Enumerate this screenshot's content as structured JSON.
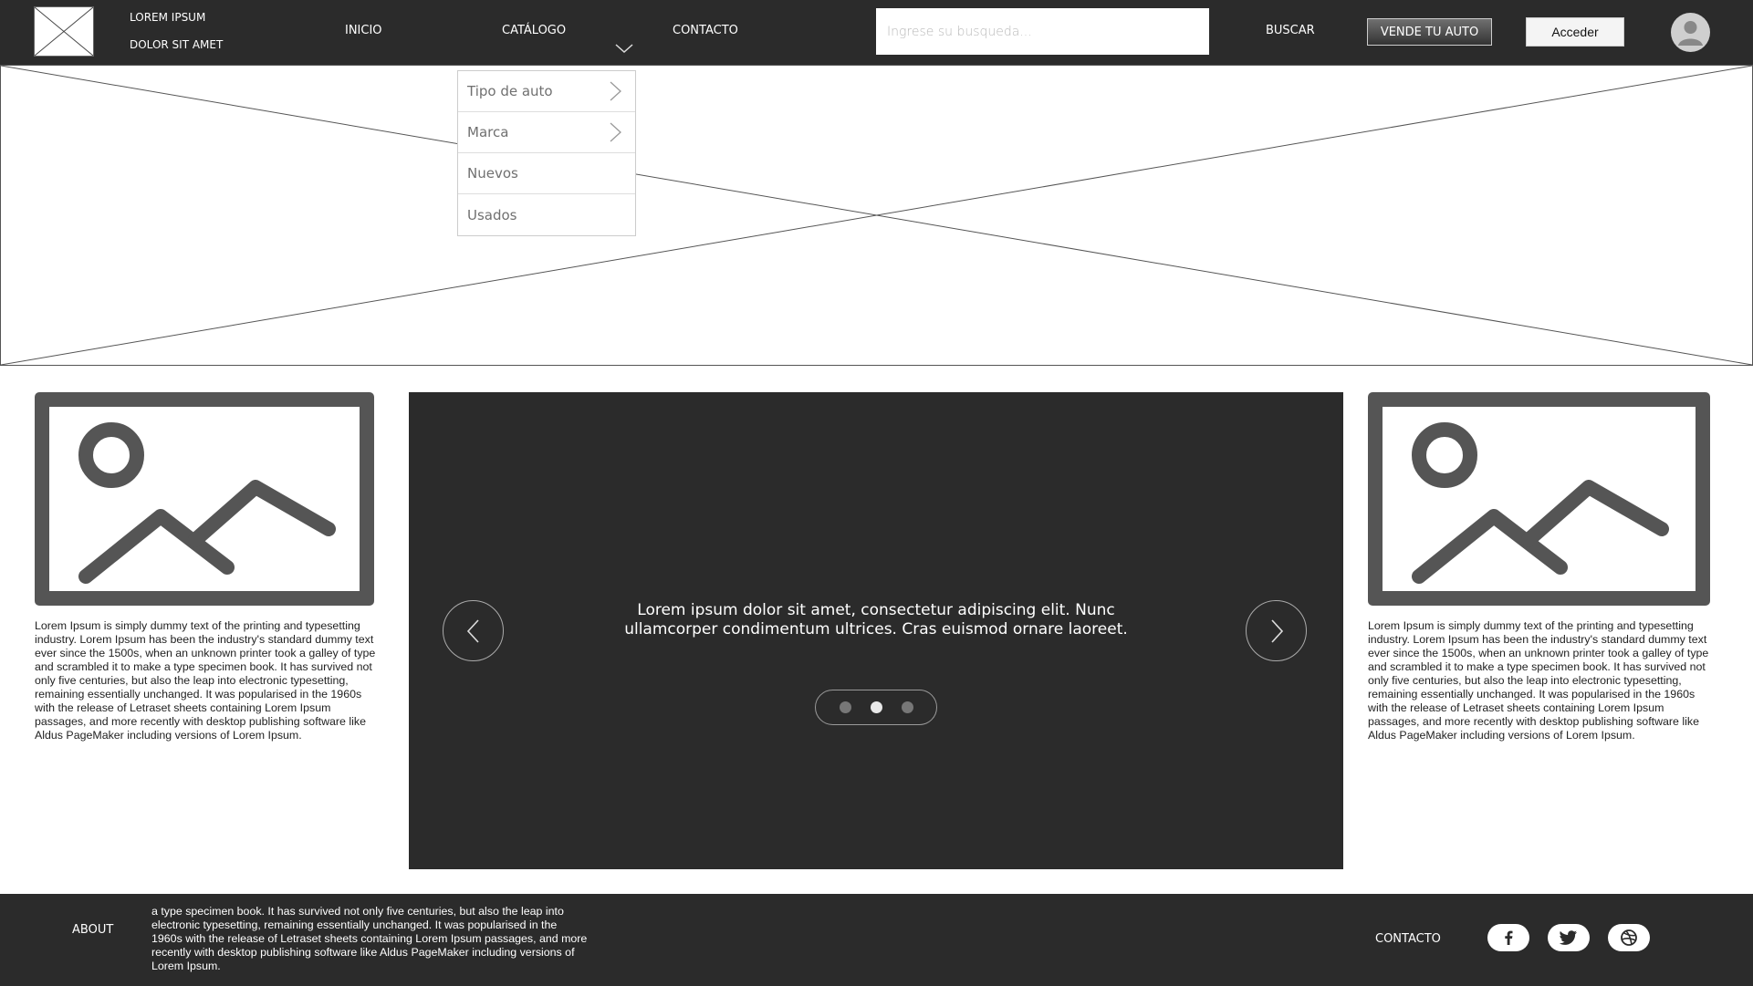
{
  "header": {
    "brand_line1": "LOREM IPSUM",
    "brand_line2": "DOLOR SIT AMET",
    "nav": [
      "INICIO",
      "CATÁLOGO",
      "CONTACTO"
    ],
    "search_placeholder": "Ingrese su busqueda...",
    "search_label": "BUSCAR",
    "sell_button": "VENDE TU AUTO",
    "login_button": "Acceder"
  },
  "dropdown": {
    "items": [
      "Tipo de auto",
      "Marca",
      "Nuevos",
      "Usados"
    ]
  },
  "cards": {
    "left_text": "Lorem Ipsum is simply dummy text of the printing and typesetting industry. Lorem Ipsum has been the industry's standard dummy text ever since the 1500s, when an unknown printer took a galley of type and scrambled it to make a type specimen book. It has survived not only five centuries, but also the leap into electronic typesetting, remaining essentially unchanged. It was popularised in the 1960s with the release of Letraset sheets containing Lorem Ipsum passages, and more recently with desktop publishing software like Aldus PageMaker including versions of Lorem Ipsum.",
    "right_text": "Lorem Ipsum is simply dummy text of the printing and typesetting industry. Lorem Ipsum has been the industry's standard dummy text ever since the 1500s, when an unknown printer took a galley of type and scrambled it to make a type specimen book. It has survived not only five centuries, but also the leap into electronic typesetting, remaining essentially unchanged. It was popularised in the 1960s with the release of Letraset sheets containing Lorem Ipsum passages, and more recently with desktop publishing software like Aldus PageMaker including versions of Lorem Ipsum."
  },
  "carousel": {
    "text": "Lorem ipsum dolor sit amet, consectetur adipiscing elit. Nunc ullamcorper condimentum ultrices. Cras euismod ornare laoreet.",
    "dot_count": 3,
    "active_dot": 2
  },
  "footer": {
    "about_label": "ABOUT",
    "about_text": "a type specimen book. It has survived not only five centuries, but also the leap into electronic typesetting, remaining essentially unchanged. It was popularised in the 1960s with the release of Letraset sheets containing Lorem Ipsum passages, and more recently with desktop publishing software like Aldus PageMaker including versions of Lorem Ipsum.",
    "contact_label": "CONTACTO",
    "social_icons": [
      "facebook-icon",
      "twitter-icon",
      "dribbble-icon"
    ]
  },
  "colors": {
    "dark_bar": "#2b2b2b",
    "placeholder_frame": "#555555",
    "white": "#ffffff"
  }
}
